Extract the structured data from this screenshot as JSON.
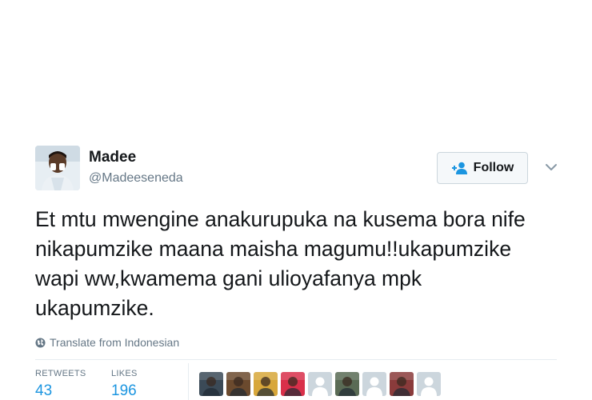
{
  "user": {
    "display_name": "Madee",
    "handle": "@Madeeseneda",
    "avatar_icon": "profile-photo"
  },
  "follow_button": {
    "label": "Follow",
    "icon": "follow-person-plus-icon",
    "accent_color": "#1b95e0"
  },
  "menu": {
    "icon": "chevron-down-icon"
  },
  "tweet": {
    "text": "Et mtu mwengine anakurupuka na kusema bora nife nikapumzike maana maisha magumu!!ukapumzike wapi ww,kwamema gani ulioyafanya mpk ukapumzike."
  },
  "translate": {
    "label": "Translate from Indonesian",
    "icon": "globe-icon"
  },
  "stats": {
    "retweets_label": "RETWEETS",
    "retweets_value": "43",
    "likes_label": "LIKES",
    "likes_value": "196"
  },
  "likers": [
    {
      "type": "photo",
      "color": "#3b4a57"
    },
    {
      "type": "photo",
      "color": "#6b4a2e"
    },
    {
      "type": "photo",
      "color": "#d8a73a"
    },
    {
      "type": "photo",
      "color": "#d9304a"
    },
    {
      "type": "default",
      "color": "#ccd6dd"
    },
    {
      "type": "photo",
      "color": "#5a6b55"
    },
    {
      "type": "default",
      "color": "#ccd6dd"
    },
    {
      "type": "photo",
      "color": "#8a3b3b"
    },
    {
      "type": "default",
      "color": "#ccd6dd"
    }
  ]
}
